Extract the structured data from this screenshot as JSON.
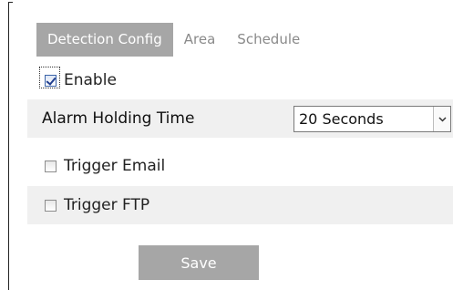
{
  "tabs": [
    {
      "label": "Detection Config",
      "active": true
    },
    {
      "label": "Area",
      "active": false
    },
    {
      "label": "Schedule",
      "active": false
    }
  ],
  "enable": {
    "label": "Enable",
    "checked": true
  },
  "alarm_holding": {
    "label": "Alarm Holding Time",
    "selected": "20 Seconds",
    "arrow_icon": "chevron-down-icon"
  },
  "trigger_email": {
    "label": "Trigger Email",
    "checked": false
  },
  "trigger_ftp": {
    "label": "Trigger FTP",
    "checked": false
  },
  "save_label": "Save",
  "colors": {
    "tab_active_bg": "#a6a6a6",
    "row_shade": "#f0f0f0",
    "button_bg": "#a6a6a6"
  }
}
